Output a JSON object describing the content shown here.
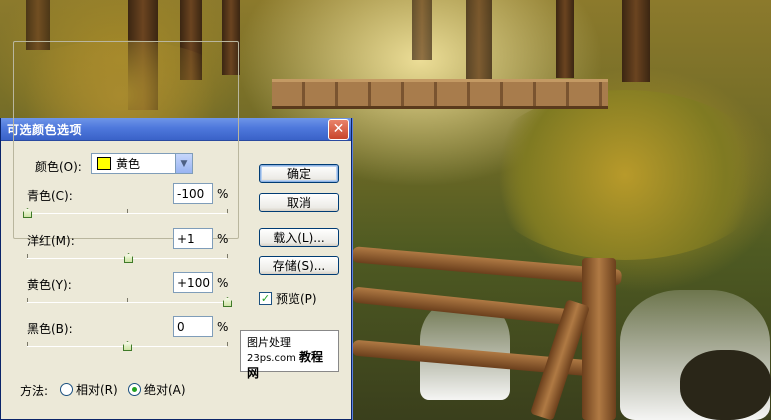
{
  "dialog": {
    "title": "可选颜色选项",
    "close_glyph": "✕",
    "colors_label": "颜色(O):",
    "colors_value": "黄色",
    "swatch_color": "#ffff00",
    "sliders": [
      {
        "label": "青色(C):",
        "value": "-100",
        "unit": "%",
        "percent": -100
      },
      {
        "label": "洋红(M):",
        "value": "+1",
        "unit": "%",
        "percent": 1
      },
      {
        "label": "黄色(Y):",
        "value": "+100",
        "unit": "%",
        "percent": 100
      },
      {
        "label": "黑色(B):",
        "value": "0",
        "unit": "%",
        "percent": 0
      }
    ],
    "buttons": {
      "ok": "确定",
      "cancel": "取消",
      "load": "载入(L)...",
      "save": "存储(S)..."
    },
    "preview": {
      "label": "预览(P)",
      "checked": true
    },
    "method": {
      "label": "方法:",
      "relative": "相对(R)",
      "absolute": "绝对(A)",
      "selected": "absolute"
    }
  },
  "watermark": {
    "line1": "图片处理",
    "site": "23ps.com",
    "line2_rest": "教程网"
  },
  "colors": {
    "titlebar": "#4e78dc",
    "dialog_bg": "#ece9d8",
    "accent_check": "#21a121"
  }
}
